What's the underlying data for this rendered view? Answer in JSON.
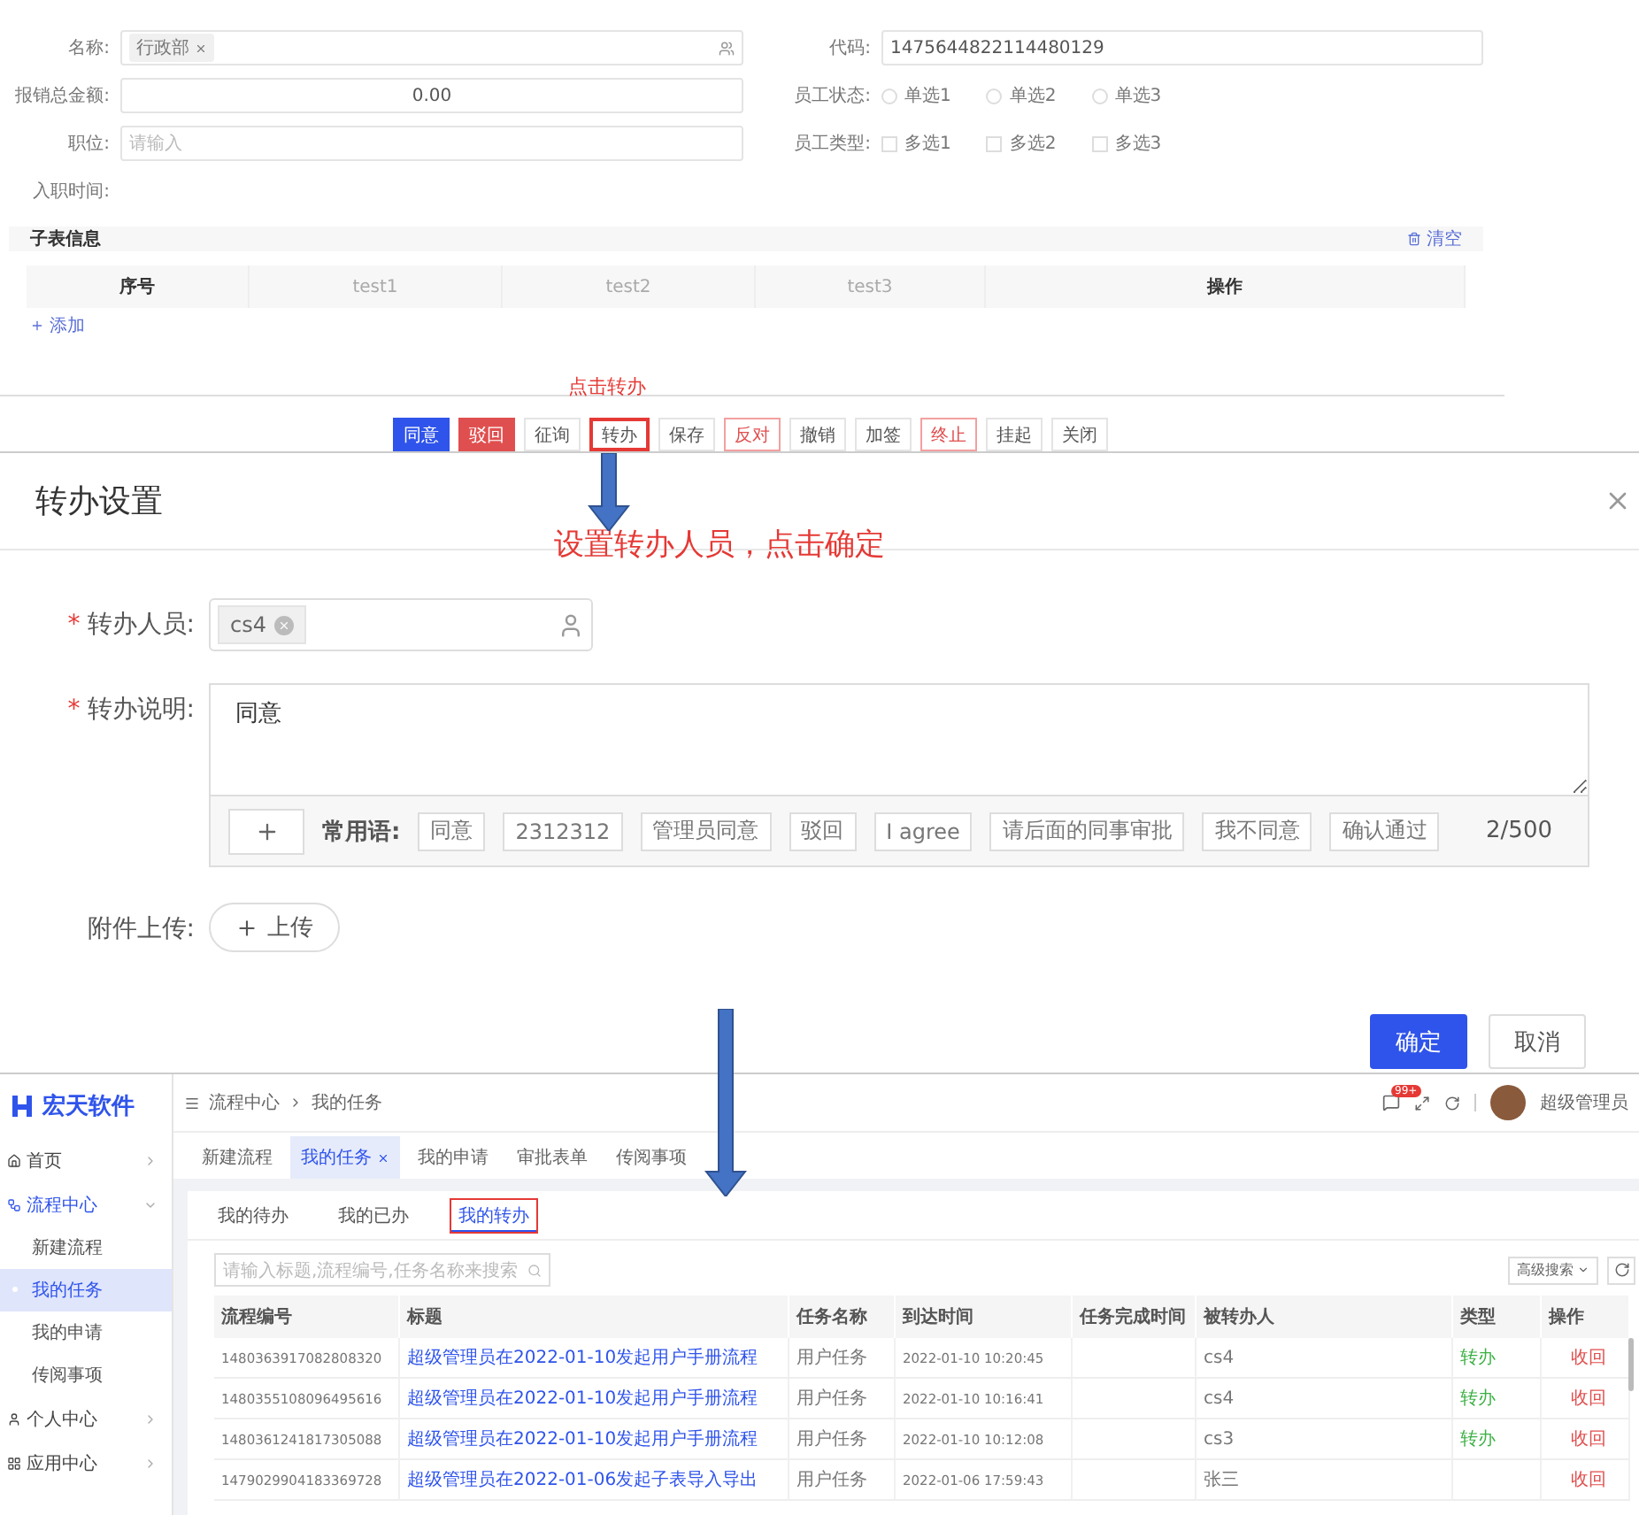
{
  "form": {
    "rows": [
      {
        "left": {
          "label": "名称:",
          "kind": "tag",
          "tag": "行政部"
        },
        "right": {
          "label": "代码:",
          "kind": "text",
          "value": "1475644822114480129"
        }
      },
      {
        "left": {
          "label": "报销总金额:",
          "kind": "number",
          "value": "0.00"
        },
        "right": {
          "label": "员工状态:",
          "kind": "radio",
          "options": [
            {
              "label": "单选1",
              "selected": false
            },
            {
              "label": "单选2",
              "selected": false
            },
            {
              "label": "单选3",
              "selected": false
            }
          ]
        }
      },
      {
        "left": {
          "label": "职位:",
          "kind": "input",
          "placeholder": "请输入"
        },
        "right": {
          "label": "员工类型:",
          "kind": "checkbox",
          "options": [
            {
              "label": "多选1",
              "checked": false
            },
            {
              "label": "多选2",
              "checked": false
            },
            {
              "label": "多选3",
              "checked": false
            }
          ]
        }
      },
      {
        "left": {
          "label": "入职时间:",
          "kind": "empty"
        }
      }
    ]
  },
  "subtable": {
    "title": "子表信息",
    "clear": "清空",
    "columns": [
      "序号",
      "test1",
      "test2",
      "test3",
      "操作"
    ],
    "add": "添加"
  },
  "actions_note": "点击转办",
  "actions": [
    {
      "label": "同意",
      "kind": "primary",
      "annotated": false
    },
    {
      "label": "驳回",
      "kind": "danger",
      "annotated": false
    },
    {
      "label": "征询",
      "kind": "default",
      "annotated": false
    },
    {
      "label": "转办",
      "kind": "default",
      "annotated": true
    },
    {
      "label": "保存",
      "kind": "default",
      "annotated": false
    },
    {
      "label": "反对",
      "kind": "danger-outline",
      "annotated": false
    },
    {
      "label": "撤销",
      "kind": "default",
      "annotated": false
    },
    {
      "label": "加签",
      "kind": "default",
      "annotated": false
    },
    {
      "label": "终止",
      "kind": "danger-outline",
      "annotated": false
    },
    {
      "label": "挂起",
      "kind": "default",
      "annotated": false
    },
    {
      "label": "关闭",
      "kind": "default",
      "annotated": false
    }
  ],
  "dialog": {
    "title": "转办设置",
    "note": "设置转办人员，点击确定",
    "assignee": {
      "required_mark": "*",
      "label": "转办人员:",
      "tag": "cs4"
    },
    "comment": {
      "required_mark": "*",
      "label": "转办说明:",
      "value": "同意",
      "phrases_label": "常用语:",
      "phrases": [
        "同意",
        "2312312",
        "管理员同意",
        "驳回",
        "I agree",
        "请后面的同事审批",
        "我不同意",
        "确认通过"
      ],
      "counter": "2/500"
    },
    "upload": {
      "label": "附件上传:",
      "button": "上传"
    },
    "buttons": [
      {
        "label": "确定",
        "kind": "primary"
      },
      {
        "label": "取消",
        "kind": "default"
      }
    ]
  },
  "app": {
    "logo": "宏天软件",
    "sidebar": [
      {
        "label": "首页",
        "expanded": false,
        "selected": false
      },
      {
        "label": "流程中心",
        "expanded": true,
        "selected": true,
        "children": [
          {
            "label": "新建流程",
            "selected": false
          },
          {
            "label": "我的任务",
            "selected": true
          },
          {
            "label": "我的申请",
            "selected": false
          },
          {
            "label": "传阅事项",
            "selected": false
          }
        ]
      },
      {
        "label": "个人中心",
        "expanded": false,
        "selected": false
      },
      {
        "label": "应用中心",
        "expanded": false,
        "selected": false
      }
    ],
    "breadcrumb": [
      "流程中心",
      "我的任务"
    ],
    "badge": "99+",
    "user": "超级管理员",
    "tabs": [
      {
        "label": "新建流程",
        "selected": false
      },
      {
        "label": "我的任务",
        "selected": true
      },
      {
        "label": "我的申请",
        "selected": false
      },
      {
        "label": "审批表单",
        "selected": false
      },
      {
        "label": "传阅事项",
        "selected": false
      }
    ],
    "subtabs": [
      {
        "label": "我的待办",
        "selected": false,
        "annotated": false
      },
      {
        "label": "我的已办",
        "selected": false,
        "annotated": false
      },
      {
        "label": "我的转办",
        "selected": true,
        "annotated": true
      }
    ],
    "search": {
      "placeholder": "请输入标题,流程编号,任务名称来搜索"
    },
    "advanced": "高级搜索",
    "columns": [
      "流程编号",
      "标题",
      "任务名称",
      "到达时间",
      "任务完成时间",
      "被转办人",
      "类型",
      "操作"
    ],
    "rows": [
      {
        "id": "1480363917082808320",
        "title": "超级管理员在2022-01-10发起用户手册流程",
        "task": "用户任务",
        "arrived": "2022-01-10 10:20:45",
        "assignee": "cs4",
        "type": "转办",
        "action": "收回"
      },
      {
        "id": "1480355108096495616",
        "title": "超级管理员在2022-01-10发起用户手册流程",
        "task": "用户任务",
        "arrived": "2022-01-10 10:16:41",
        "assignee": "cs4",
        "type": "转办",
        "action": "收回"
      },
      {
        "id": "1480361241817305088",
        "title": "超级管理员在2022-01-10发起用户手册流程",
        "task": "用户任务",
        "arrived": "2022-01-10 10:12:08",
        "assignee": "cs3",
        "type": "转办",
        "action": "收回"
      },
      {
        "id": "1479029904183369728",
        "title": "超级管理员在2022-01-06发起子表导入导出",
        "task": "用户任务",
        "arrived": "2022-01-06 17:59:43",
        "assignee": "张三",
        "action": "收回"
      }
    ]
  }
}
